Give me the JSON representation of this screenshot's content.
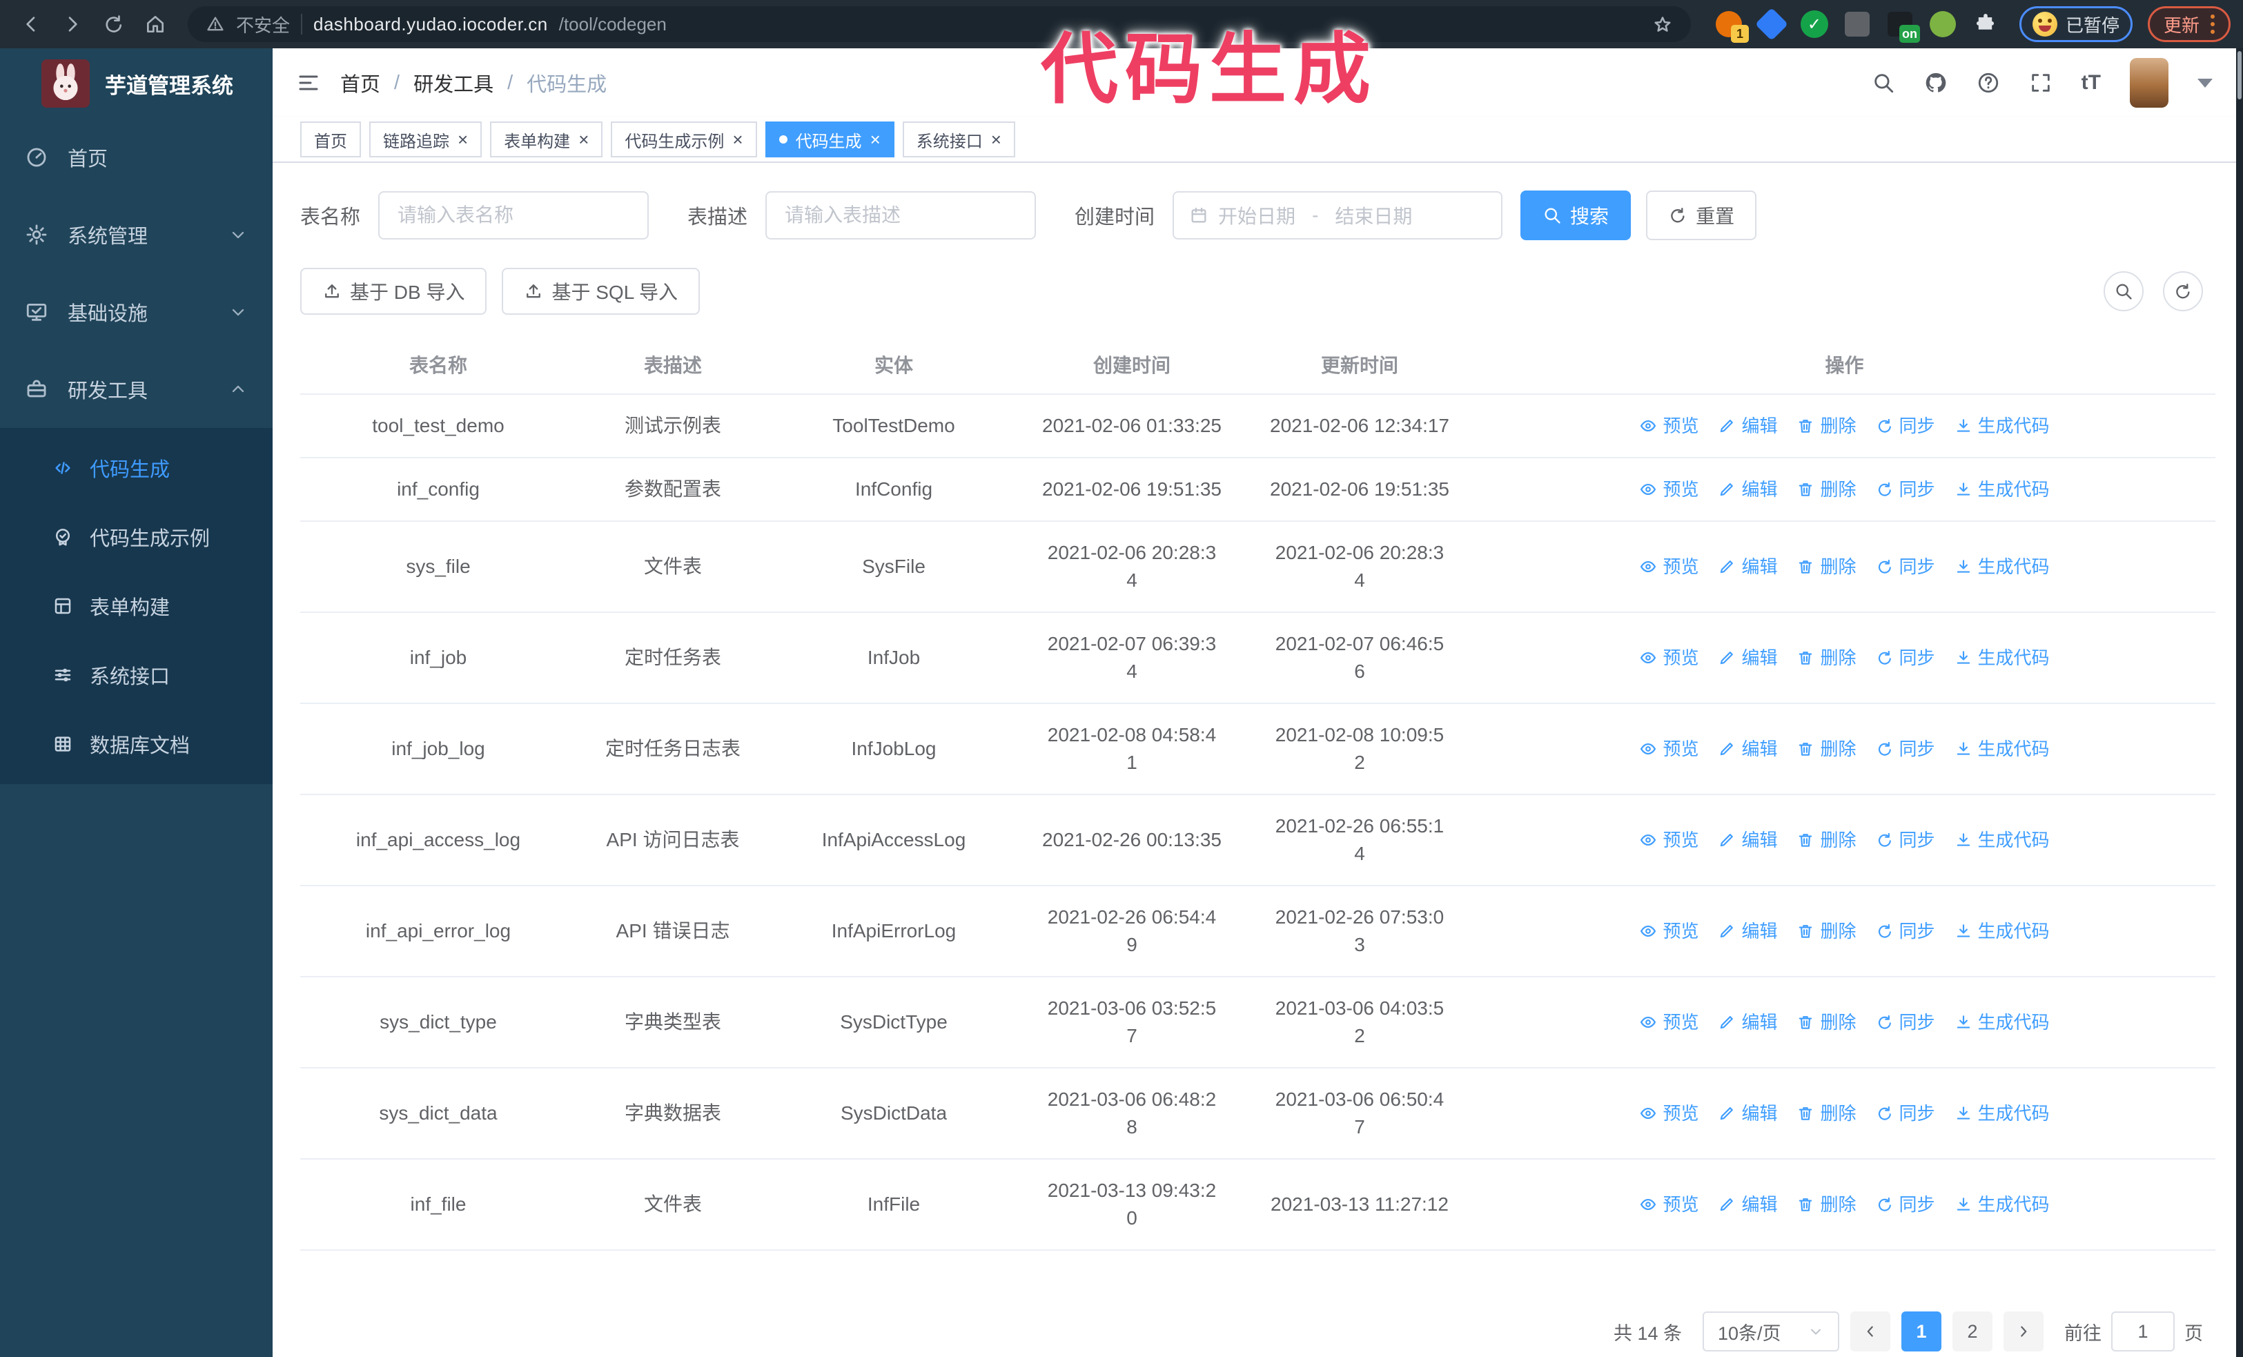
{
  "browser": {
    "insecure_label": "不安全",
    "url_host": "dashboard.yudao.iocoder.cn",
    "url_path": "/tool/codegen",
    "ext_badge_count": "1",
    "ext_on_label": "on",
    "paused_label": "已暂停",
    "update_label": "更新"
  },
  "watermark": {
    "text": "代码生成",
    "color": "#ee3f63"
  },
  "sidebar": {
    "title": "芋道管理系统",
    "menu": [
      {
        "key": "home",
        "label": "首页",
        "icon": "dashboard",
        "chevron": null,
        "active": false
      },
      {
        "key": "system",
        "label": "系统管理",
        "icon": "gear",
        "chevron": "down",
        "active": false
      },
      {
        "key": "infra",
        "label": "基础设施",
        "icon": "monitor",
        "chevron": "down",
        "active": false
      },
      {
        "key": "dev-tools",
        "label": "研发工具",
        "icon": "toolbox",
        "chevron": "up",
        "active": false
      }
    ],
    "submenu": [
      {
        "key": "codegen",
        "label": "代码生成",
        "icon": "code",
        "active": true
      },
      {
        "key": "codegen-demo",
        "label": "代码生成示例",
        "icon": "badge",
        "active": false
      },
      {
        "key": "form-build",
        "label": "表单构建",
        "icon": "form",
        "active": false
      },
      {
        "key": "system-api",
        "label": "系统接口",
        "icon": "sliders",
        "active": false
      },
      {
        "key": "db-doc",
        "label": "数据库文档",
        "icon": "dbdoc",
        "active": false
      }
    ]
  },
  "breadcrumb": [
    "首页",
    "研发工具",
    "代码生成"
  ],
  "tabs": [
    {
      "key": "home",
      "label": "首页",
      "closable": false,
      "active": false
    },
    {
      "key": "trace",
      "label": "链路追踪",
      "closable": true,
      "active": false
    },
    {
      "key": "form-build",
      "label": "表单构建",
      "closable": true,
      "active": false
    },
    {
      "key": "codegen-demo",
      "label": "代码生成示例",
      "closable": true,
      "active": false
    },
    {
      "key": "codegen",
      "label": "代码生成",
      "closable": true,
      "active": true
    },
    {
      "key": "system-api",
      "label": "系统接口",
      "closable": true,
      "active": false
    }
  ],
  "filters": {
    "name_label": "表名称",
    "name_placeholder": "请输入表名称",
    "desc_label": "表描述",
    "desc_placeholder": "请输入表描述",
    "time_label": "创建时间",
    "start_placeholder": "开始日期",
    "range_separator": "-",
    "end_placeholder": "结束日期",
    "search_label": "搜索",
    "reset_label": "重置"
  },
  "toolbar": {
    "import_db_label": "基于 DB 导入",
    "import_sql_label": "基于 SQL 导入"
  },
  "table": {
    "columns": [
      "表名称",
      "表描述",
      "实体",
      "创建时间",
      "更新时间",
      "操作"
    ],
    "action_labels": [
      "预览",
      "编辑",
      "删除",
      "同步",
      "生成代码"
    ],
    "action_icons": [
      "eye",
      "edit",
      "trash",
      "sync",
      "download"
    ],
    "rows": [
      {
        "name": "tool_test_demo",
        "desc": "测试示例表",
        "entity": "ToolTestDemo",
        "created": "2021-02-06 01:33:25",
        "updated": "2021-02-06 12:34:17"
      },
      {
        "name": "inf_config",
        "desc": "参数配置表",
        "entity": "InfConfig",
        "created": "2021-02-06 19:51:35",
        "updated": "2021-02-06 19:51:35"
      },
      {
        "name": "sys_file",
        "desc": "文件表",
        "entity": "SysFile",
        "created": "2021-02-06 20:28:3\n4",
        "updated": "2021-02-06 20:28:3\n4"
      },
      {
        "name": "inf_job",
        "desc": "定时任务表",
        "entity": "InfJob",
        "created": "2021-02-07 06:39:3\n4",
        "updated": "2021-02-07 06:46:5\n6"
      },
      {
        "name": "inf_job_log",
        "desc": "定时任务日志表",
        "entity": "InfJobLog",
        "created": "2021-02-08 04:58:4\n1",
        "updated": "2021-02-08 10:09:5\n2"
      },
      {
        "name": "inf_api_access_log",
        "desc": "API 访问日志表",
        "entity": "InfApiAccessLog",
        "created": "2021-02-26 00:13:35",
        "updated": "2021-02-26 06:55:1\n4"
      },
      {
        "name": "inf_api_error_log",
        "desc": "API 错误日志",
        "entity": "InfApiErrorLog",
        "created": "2021-02-26 06:54:4\n9",
        "updated": "2021-02-26 07:53:0\n3"
      },
      {
        "name": "sys_dict_type",
        "desc": "字典类型表",
        "entity": "SysDictType",
        "created": "2021-03-06 03:52:5\n7",
        "updated": "2021-03-06 04:03:5\n2"
      },
      {
        "name": "sys_dict_data",
        "desc": "字典数据表",
        "entity": "SysDictData",
        "created": "2021-03-06 06:48:2\n8",
        "updated": "2021-03-06 06:50:4\n7"
      },
      {
        "name": "inf_file",
        "desc": "文件表",
        "entity": "InfFile",
        "created": "2021-03-13 09:43:2\n0",
        "updated": "2021-03-13 11:27:12"
      }
    ]
  },
  "pagination": {
    "total": "共 14 条",
    "page_size": "10条/页",
    "pages": [
      "1",
      "2"
    ],
    "active_page": "1",
    "goto_label": "前往",
    "goto_value": "1",
    "goto_suffix": "页"
  },
  "colors": {
    "accent": "#409eff",
    "sidebar_bg": "#204459",
    "submenu_bg": "#17374e",
    "chrome_bg": "#232d36",
    "watermark": "#ee3f63",
    "table_border": "#ebeef5"
  }
}
